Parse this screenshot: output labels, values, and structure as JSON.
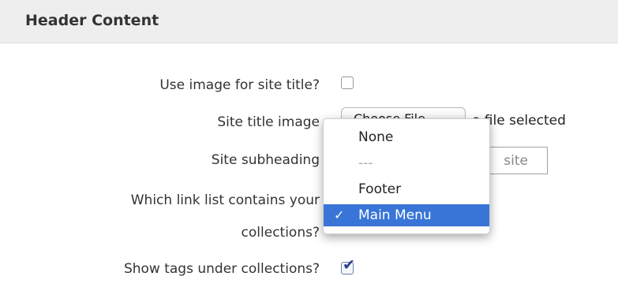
{
  "header": {
    "title": "Header Content"
  },
  "form": {
    "use_image_label": "Use image for site title?",
    "use_image_checked": false,
    "site_title_image_label": "Site title image",
    "file_button_label": "Choose File",
    "file_status": "o file selected",
    "site_subheading_label": "Site subheading",
    "site_subheading_value": "site",
    "link_list_label_line1": "Which link list contains your",
    "link_list_label_line2": "collections?",
    "show_tags_label": "Show tags under collections?",
    "show_tags_checked": true,
    "check_glyph": "✔"
  },
  "dropdown": {
    "options": [
      {
        "label": "None",
        "selected": false
      },
      {
        "label": "---",
        "selected": false
      },
      {
        "label": "Footer",
        "selected": false
      },
      {
        "label": "Main Menu",
        "selected": true
      }
    ],
    "selected_check": "✓"
  },
  "colors": {
    "header_bg": "#eeeeee",
    "selection_bg": "#3875d7",
    "checkbox_check": "#2a3f86"
  }
}
